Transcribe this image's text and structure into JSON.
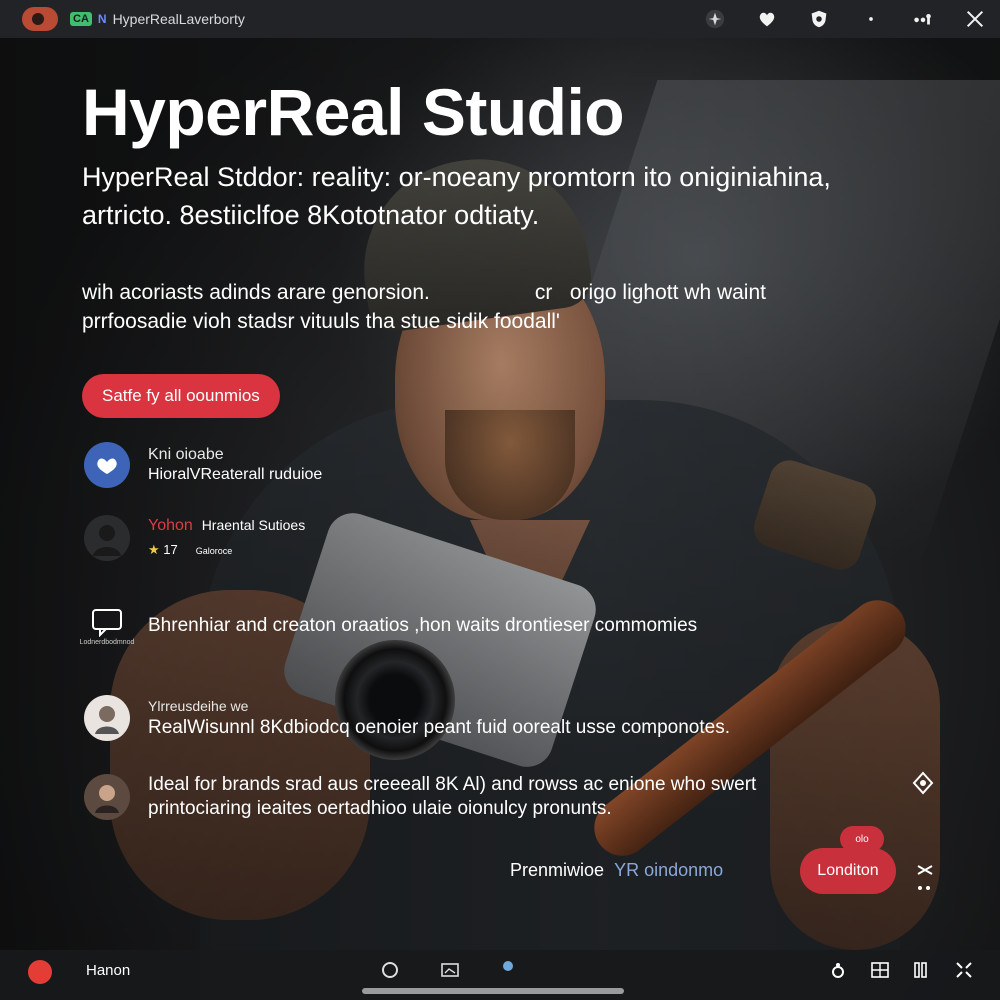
{
  "topbar": {
    "badge": "CA",
    "n": "N",
    "title": "HyperRealLaverborty"
  },
  "hero": {
    "title": "HyperReal Studio",
    "subtitle_line1": "HyperReal Stddor: reality:  or-noeany promtorn ito oniginiahina,",
    "subtitle_line2": "artricto. 8estiiclfoe 8Kototnator odtiaty.",
    "desc_line1": "wih acoriasts adinds arare genorsion.                  cr   origo lighott wh waint",
    "desc_line2": "prrfoosadie vioh stadsr vituuls tha stue sidik foodall'",
    "cta_label": "Satfe fy all oounmios"
  },
  "rows": [
    {
      "line1": "Kni oioabe",
      "line2": "HioralVReaterall ruduioe"
    },
    {
      "red": "Yohon",
      "name": "Hraental Sutioes",
      "stars": "★",
      "rating": "17",
      "tiny": "Galoroce"
    },
    {
      "text": "Bhrenhiar and creaton oraatios ,hon waits drontieser commomies",
      "caption": "Lodnerdbodmnod"
    },
    {
      "line1": "Ylrreusdeihe we",
      "line2": "RealWisunnl 8Kdbiodcq oenoier peant fuid oorealt usse componotes."
    },
    {
      "line1": "Ideal for brands srad aus creeeall 8K Al) and rowss ac enione who swert",
      "line2": "printociaring ieaites oertadhioo ulaie oionulcy pronunts."
    }
  ],
  "bottom": {
    "inline_left": "Prenmiwioe",
    "inline_right": "YR oindonmo",
    "pill_label": "Londiton",
    "pill_small": "olo",
    "name": "Hanon"
  }
}
